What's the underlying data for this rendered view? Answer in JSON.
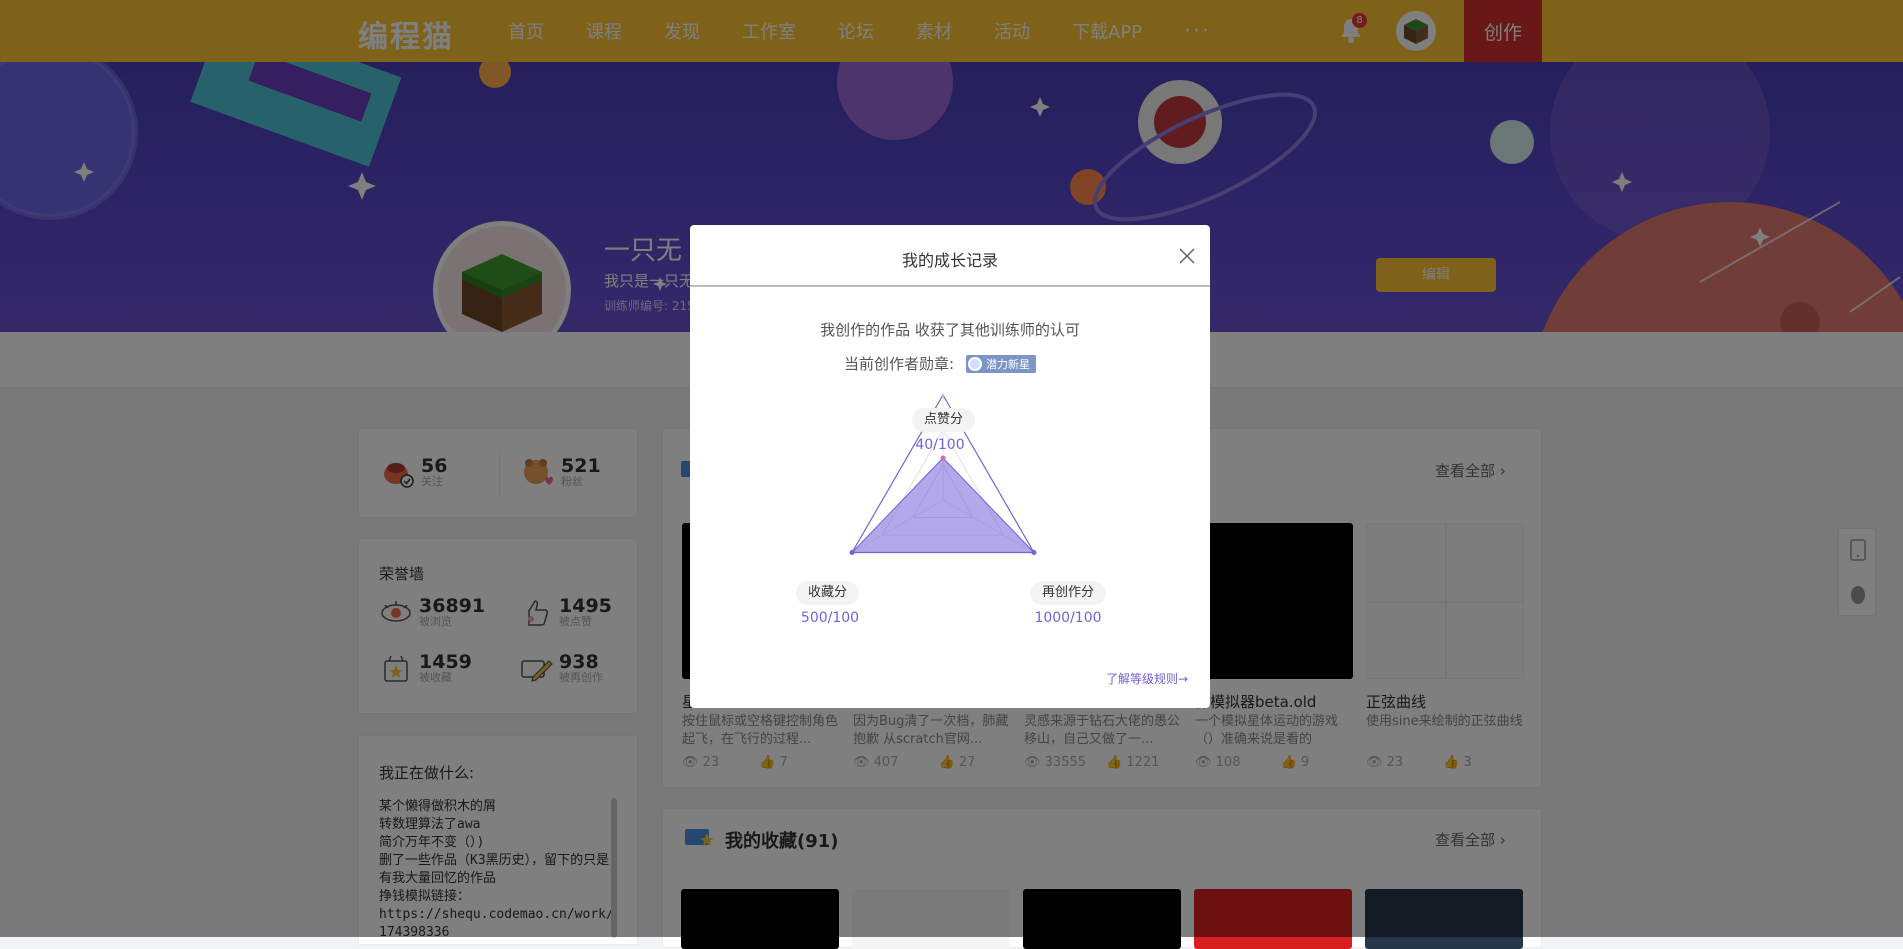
{
  "topbar": {
    "logo": "编程猫",
    "nav": [
      "首页",
      "课程",
      "发现",
      "工作室",
      "论坛",
      "素材",
      "活动",
      "下载APP"
    ],
    "more": "···",
    "notification_count": "8",
    "create_label": "创作",
    "brand_color": "#fec433"
  },
  "profile": {
    "name": "一只无",
    "signature": "我只是一只无",
    "trainer_id": "训练师编号: 215",
    "edit_label": "编辑"
  },
  "stats": {
    "following": {
      "num": "56",
      "label": "关注"
    },
    "fans": {
      "num": "521",
      "label": "粉丝"
    }
  },
  "honor": {
    "title": "荣誉墙",
    "items": [
      {
        "num": "36891",
        "label": "被浏览"
      },
      {
        "num": "1495",
        "label": "被点赞"
      },
      {
        "num": "1459",
        "label": "被收藏"
      },
      {
        "num": "938",
        "label": "被再创作"
      }
    ]
  },
  "doing": {
    "title": "我正在做什么:",
    "text": "某个懒得做积木的屑\n转数理算法了awa\n简介万年不变（）)\n删了一些作品（K3黑历史），留下的只是有我大量回忆的作品\n挣钱模拟链接：\nhttps://shequ.codemao.cn/work/174398336"
  },
  "works": {
    "view_all": "查看全部",
    "items": [
      {
        "title": "星",
        "desc": "按住鼠标或空格键控制角色起飞，在飞行的过程...",
        "views": "23",
        "likes": "7"
      },
      {
        "title": "",
        "desc": "因为Bug清了一次档，肺藏抱歉 从scratch官网...",
        "views": "407",
        "likes": "27"
      },
      {
        "title": "",
        "desc": "灵感来源于钻石大佬的愚公移山，自己又做了一...",
        "views": "33555",
        "likes": "1221"
      },
      {
        "title": "体模拟器beta.old",
        "desc": "一个模拟星体运动的游戏（）准确来说是看的",
        "views": "108",
        "likes": "9"
      },
      {
        "title": "正弦曲线",
        "desc": "使用sine来绘制的正弦曲线",
        "views": "23",
        "likes": "3"
      }
    ]
  },
  "collection": {
    "title": "我的收藏(91)",
    "view_all": "查看全部"
  },
  "modal": {
    "title": "我的成长记录",
    "subtitle": "我创作的作品 收获了其他训练师的认可",
    "badge_label": "当前创作者勋章:",
    "medal_name": "潜力新星",
    "rule_link": "了解等级规则→",
    "accent_color": "#7461d9"
  },
  "chart_data": {
    "type": "radar",
    "axes": [
      {
        "name": "点赞分",
        "value": 40,
        "max": 100,
        "display": "40/100"
      },
      {
        "name": "再创作分",
        "value": 1000,
        "max": 100,
        "display": "1000/100"
      },
      {
        "name": "收藏分",
        "value": 500,
        "max": 100,
        "display": "500/100"
      }
    ]
  }
}
